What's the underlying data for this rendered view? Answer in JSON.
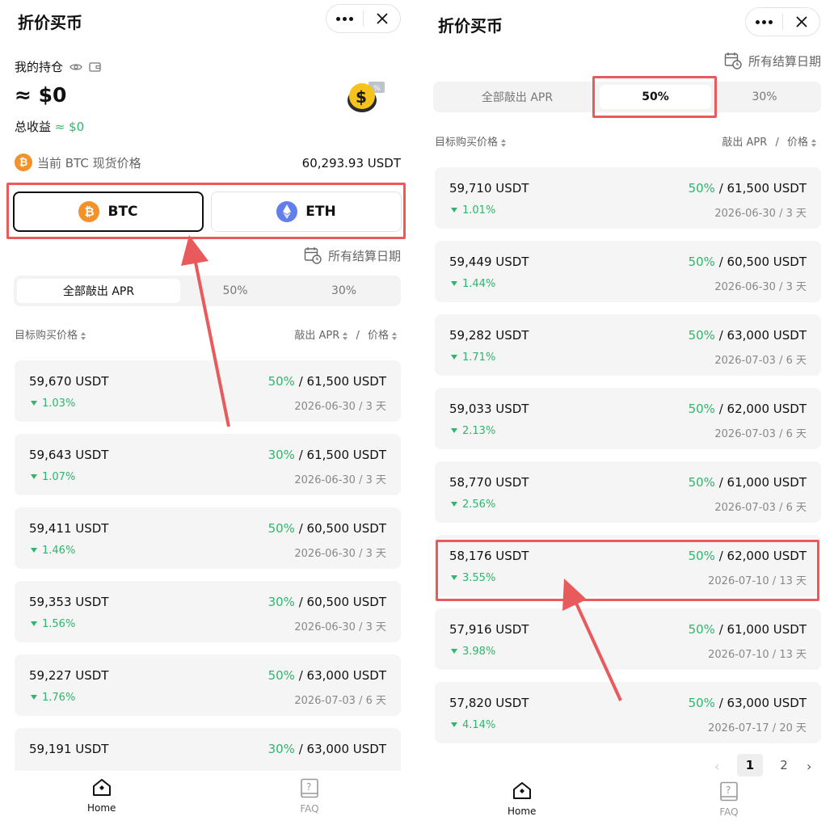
{
  "app": {
    "title": "折价买币",
    "icons": {
      "more": "more-dots-icon",
      "close": "close-icon"
    }
  },
  "left": {
    "holdings_label": "我的持仓",
    "holdings_value": "≈ $0",
    "earnings_label": "总收益",
    "earnings_value": "≈ $0",
    "spot_label": "当前 BTC 现货价格",
    "spot_value": "60,293.93 USDT",
    "coins": [
      {
        "label": "BTC",
        "symbol": "₿",
        "selected": true
      },
      {
        "label": "ETH",
        "symbol": "◆",
        "selected": false
      }
    ],
    "settlement_label": "所有结算日期",
    "tabs": [
      "全部敲出 APR",
      "50%",
      "30%"
    ],
    "active_tab": 0,
    "col_left": "目标购买价格",
    "col_right_a": "敲出 APR",
    "col_right_sep": "/",
    "col_right_b": "价格",
    "rows": [
      {
        "price": "59,670 USDT",
        "pct": "1.03%",
        "apr": "50%",
        "target": "/ 61,500 USDT",
        "date": "2026-06-30 / 3 天"
      },
      {
        "price": "59,643 USDT",
        "pct": "1.07%",
        "apr": "30%",
        "target": "/ 61,500 USDT",
        "date": "2026-06-30 / 3 天"
      },
      {
        "price": "59,411 USDT",
        "pct": "1.46%",
        "apr": "50%",
        "target": "/ 60,500 USDT",
        "date": "2026-06-30 / 3 天"
      },
      {
        "price": "59,353 USDT",
        "pct": "1.56%",
        "apr": "30%",
        "target": "/ 60,500 USDT",
        "date": "2026-06-30 / 3 天"
      },
      {
        "price": "59,227 USDT",
        "pct": "1.76%",
        "apr": "50%",
        "target": "/ 63,000 USDT",
        "date": "2026-07-03 / 6 天"
      },
      {
        "price": "59,191 USDT",
        "pct": "",
        "apr": "30%",
        "target": "/ 63,000 USDT",
        "date": ""
      }
    ]
  },
  "right": {
    "settlement_label": "所有结算日期",
    "tabs": [
      "全部敲出 APR",
      "50%",
      "30%"
    ],
    "active_tab": 1,
    "col_left": "目标购买价格",
    "col_right_a": "敲出 APR",
    "col_right_sep": "/",
    "col_right_b": "价格",
    "rows": [
      {
        "price": "59,710 USDT",
        "pct": "1.01%",
        "apr": "50%",
        "target": "/ 61,500 USDT",
        "date": "2026-06-30 / 3 天"
      },
      {
        "price": "59,449 USDT",
        "pct": "1.44%",
        "apr": "50%",
        "target": "/ 60,500 USDT",
        "date": "2026-06-30 / 3 天"
      },
      {
        "price": "59,282 USDT",
        "pct": "1.71%",
        "apr": "50%",
        "target": "/ 63,000 USDT",
        "date": "2026-07-03 / 6 天"
      },
      {
        "price": "59,033 USDT",
        "pct": "2.13%",
        "apr": "50%",
        "target": "/ 62,000 USDT",
        "date": "2026-07-03 / 6 天"
      },
      {
        "price": "58,770 USDT",
        "pct": "2.56%",
        "apr": "50%",
        "target": "/ 61,000 USDT",
        "date": "2026-07-03 / 6 天"
      },
      {
        "price": "58,176 USDT",
        "pct": "3.55%",
        "apr": "50%",
        "target": "/ 62,000 USDT",
        "date": "2026-07-10 / 13 天"
      },
      {
        "price": "57,916 USDT",
        "pct": "3.98%",
        "apr": "50%",
        "target": "/ 61,000 USDT",
        "date": "2026-07-10 / 13 天"
      },
      {
        "price": "57,820 USDT",
        "pct": "4.14%",
        "apr": "50%",
        "target": "/ 63,000 USDT",
        "date": "2026-07-17 / 20 天"
      }
    ],
    "pagination": {
      "pages": [
        "1",
        "2"
      ],
      "active": 0
    }
  },
  "tabbar": {
    "home": "Home",
    "faq": "FAQ"
  },
  "colors": {
    "accent_green": "#2fb56c",
    "annotation_red": "#e85a5c",
    "btc_orange": "#f3922a",
    "eth_purple": "#627eea"
  }
}
